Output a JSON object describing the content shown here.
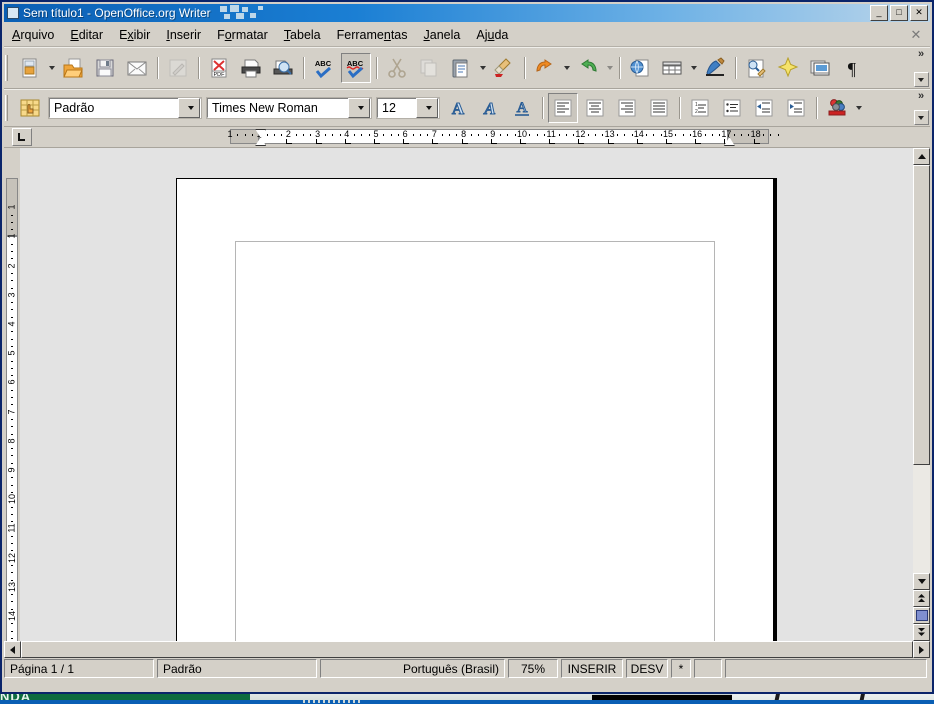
{
  "window": {
    "title": "Sem título1 - OpenOffice.org Writer",
    "app_icon": "document-icon",
    "buttons": {
      "minimize": "_",
      "maximize": "□",
      "close": "✕"
    }
  },
  "menubar": {
    "items": [
      {
        "label": "Arquivo",
        "accel": "A"
      },
      {
        "label": "Editar",
        "accel": "E"
      },
      {
        "label": "Exibir",
        "accel": "x"
      },
      {
        "label": "Inserir",
        "accel": "I"
      },
      {
        "label": "Formatar",
        "accel": "o"
      },
      {
        "label": "Tabela",
        "accel": "T"
      },
      {
        "label": "Ferramentas",
        "accel": "n"
      },
      {
        "label": "Janela",
        "accel": "J"
      },
      {
        "label": "Ajuda",
        "accel": "u"
      }
    ],
    "close_document": "✕"
  },
  "toolbar_main": {
    "overflow": "»",
    "buttons": [
      {
        "name": "new-document",
        "tooltip": "Novo",
        "icon": "new-doc-icon",
        "dropdown": true,
        "disabled": false,
        "pressed": false
      },
      {
        "name": "open-document",
        "tooltip": "Abrir",
        "icon": "open-folder-icon",
        "dropdown": false,
        "disabled": false,
        "pressed": false
      },
      {
        "name": "save-document",
        "tooltip": "Salvar",
        "icon": "floppy-disk-icon",
        "dropdown": false,
        "disabled": false,
        "pressed": false
      },
      {
        "name": "send-email",
        "tooltip": "Documento como e-mail",
        "icon": "envelope-icon",
        "dropdown": false,
        "disabled": false,
        "pressed": false
      },
      {
        "name": "edit-file",
        "tooltip": "Editar arquivo",
        "icon": "edit-file-icon",
        "dropdown": false,
        "disabled": true,
        "pressed": false
      },
      {
        "name": "export-pdf",
        "tooltip": "Exportar como PDF",
        "icon": "pdf-icon",
        "dropdown": false,
        "disabled": false,
        "pressed": false
      },
      {
        "name": "print-document",
        "tooltip": "Imprimir",
        "icon": "printer-icon",
        "dropdown": false,
        "disabled": false,
        "pressed": false
      },
      {
        "name": "print-preview",
        "tooltip": "Visualizar página",
        "icon": "preview-icon",
        "dropdown": false,
        "disabled": false,
        "pressed": false
      },
      {
        "name": "spelling-check",
        "tooltip": "Ortografia e gramática",
        "icon": "abc-check-icon",
        "dropdown": false,
        "disabled": false,
        "pressed": false
      },
      {
        "name": "autospellcheck",
        "tooltip": "Verificação automática",
        "icon": "abc-wavy-icon",
        "dropdown": false,
        "disabled": false,
        "pressed": true
      },
      {
        "name": "cut",
        "tooltip": "Cortar",
        "icon": "scissors-icon",
        "dropdown": false,
        "disabled": true,
        "pressed": false
      },
      {
        "name": "copy",
        "tooltip": "Copiar",
        "icon": "copy-icon",
        "dropdown": false,
        "disabled": true,
        "pressed": false
      },
      {
        "name": "paste",
        "tooltip": "Colar",
        "icon": "clipboard-icon",
        "dropdown": true,
        "disabled": false,
        "pressed": false
      },
      {
        "name": "clone-formatting",
        "tooltip": "Pincel de estilo",
        "icon": "paintbrush-icon",
        "dropdown": false,
        "disabled": false,
        "pressed": false
      },
      {
        "name": "undo",
        "tooltip": "Desfazer",
        "icon": "undo-arrow-icon",
        "dropdown": true,
        "disabled": false,
        "pressed": false
      },
      {
        "name": "redo",
        "tooltip": "Refazer",
        "icon": "redo-arrow-icon",
        "dropdown": true,
        "disabled": true,
        "pressed": false
      },
      {
        "name": "hyperlink",
        "tooltip": "Hyperlink",
        "icon": "globe-page-icon",
        "dropdown": false,
        "disabled": false,
        "pressed": false
      },
      {
        "name": "insert-table",
        "tooltip": "Tabela",
        "icon": "table-grid-icon",
        "dropdown": true,
        "disabled": false,
        "pressed": false
      },
      {
        "name": "draw-functions",
        "tooltip": "Funções de desenho",
        "icon": "pen-draw-icon",
        "dropdown": false,
        "disabled": false,
        "pressed": false
      },
      {
        "name": "find-replace",
        "tooltip": "Localizar e substituir",
        "icon": "find-replace-icon",
        "dropdown": false,
        "disabled": false,
        "pressed": false
      },
      {
        "name": "gallery",
        "tooltip": "Galeria",
        "icon": "star-gallery-icon",
        "dropdown": false,
        "disabled": false,
        "pressed": false
      },
      {
        "name": "data-sources",
        "tooltip": "Fontes de dados",
        "icon": "data-sources-icon",
        "dropdown": false,
        "disabled": false,
        "pressed": false
      },
      {
        "name": "formatting-marks",
        "tooltip": "Caracteres não imprimíveis",
        "icon": "pilcrow-icon",
        "dropdown": false,
        "disabled": false,
        "pressed": false
      }
    ]
  },
  "toolbar_format": {
    "overflow": "»",
    "styles_icon": "paragraph-styles-icon",
    "paragraph_style": {
      "value": "Padrão"
    },
    "font_name": {
      "value": "Times New Roman"
    },
    "font_size": {
      "value": "12"
    },
    "buttons": [
      {
        "name": "bold",
        "tooltip": "Negrito",
        "icon": "bold-a-icon",
        "pressed": false
      },
      {
        "name": "italic",
        "tooltip": "Itálico",
        "icon": "italic-a-icon",
        "pressed": false
      },
      {
        "name": "underline",
        "tooltip": "Sublinhado",
        "icon": "underline-a-icon",
        "pressed": false
      },
      {
        "name": "align-left",
        "tooltip": "Alinhar à esquerda",
        "icon": "align-left-icon",
        "pressed": true
      },
      {
        "name": "align-center",
        "tooltip": "Centralizado",
        "icon": "align-center-icon",
        "pressed": false
      },
      {
        "name": "align-right",
        "tooltip": "Alinhar à direita",
        "icon": "align-right-icon",
        "pressed": false
      },
      {
        "name": "align-justify",
        "tooltip": "Justificado",
        "icon": "align-justify-icon",
        "pressed": false
      },
      {
        "name": "numbered-list",
        "tooltip": "Lista numerada",
        "icon": "numbered-list-icon",
        "pressed": false
      },
      {
        "name": "bulleted-list",
        "tooltip": "Lista com marcadores",
        "icon": "bullet-list-icon",
        "pressed": false
      },
      {
        "name": "decrease-indent",
        "tooltip": "Diminuir recuo",
        "icon": "decrease-indent-icon",
        "pressed": false
      },
      {
        "name": "increase-indent",
        "tooltip": "Aumentar recuo",
        "icon": "increase-indent-icon",
        "pressed": false
      },
      {
        "name": "font-color",
        "tooltip": "Cor da fonte",
        "icon": "font-color-icon",
        "pressed": false
      }
    ]
  },
  "ruler": {
    "tab_selector_icon": "tab-left-icon",
    "horizontal": {
      "numbers": [
        "1",
        "1",
        "2",
        "3",
        "4",
        "5",
        "6",
        "7",
        "8",
        "9",
        "10",
        "11",
        "12",
        "13",
        "14",
        "15",
        "16",
        "17",
        "18"
      ],
      "left_indent_at": "1",
      "right_indent_at": "17"
    },
    "vertical": {
      "numbers": [
        "1",
        "1",
        "2",
        "3",
        "4",
        "5",
        "6",
        "7",
        "8",
        "9",
        "10",
        "11",
        "12",
        "13",
        "14"
      ]
    }
  },
  "document": {
    "page_background": "#ffffff",
    "workspace_background": "#e3e3e3",
    "text_boundary_color": "#b5b5b5",
    "content": ""
  },
  "scrollbars": {
    "vertical": {
      "up": "▲",
      "down": "▼",
      "prev_page": "▲▲",
      "navigation": "navigation-icon",
      "next_page": "▼▼"
    },
    "horizontal": {
      "left": "◄",
      "right": "►"
    }
  },
  "statusbar": {
    "page": "Página 1 / 1",
    "page_style": "Padrão",
    "language": "Português (Brasil)",
    "zoom": "75%",
    "insert_mode": "INSERIR",
    "selection_mode": "DESV",
    "modified": "*",
    "signature": "",
    "extra": ""
  },
  "desktop": {
    "wallpaper_text": "NDA",
    "accent": "#0a5fb4"
  }
}
